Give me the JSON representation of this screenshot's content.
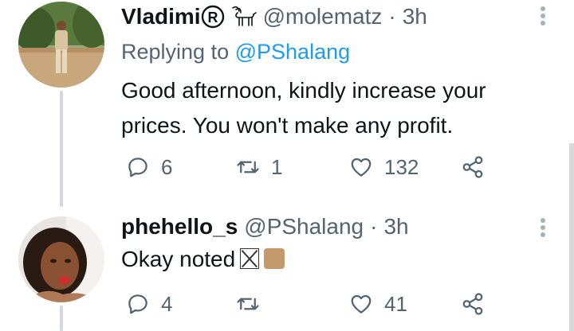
{
  "tweets": [
    {
      "display_name": "Vladimi",
      "handle": "@molematz",
      "separator": "·",
      "time": "3h",
      "replying_label": "Replying to",
      "replying_mention": "@PShalang",
      "text_line1": "Good afternoon, kindly increase your",
      "text_line2": "prices. You won't make any profit.",
      "reply_count": "6",
      "retweet_count": "1",
      "like_count": "132",
      "name_emoji_icons": [
        "registered-icon",
        "goat-icon"
      ]
    },
    {
      "display_name": "phehello_s",
      "handle": "@PShalang",
      "separator": "·",
      "time": "3h",
      "text": "Okay noted",
      "text_emoji_icons": [
        "missing-glyph-icon",
        "skin-tone-modifier-icon"
      ],
      "skin_tone_color": "#c49a6c",
      "reply_count": "4",
      "retweet_count": "",
      "like_count": "41"
    }
  ],
  "colors": {
    "link": "#1d9bf0",
    "secondary_text": "#536471",
    "thread_line": "#cfd9de"
  }
}
